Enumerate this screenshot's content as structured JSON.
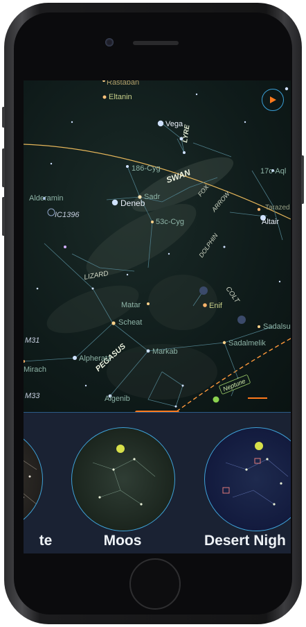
{
  "sky_map": {
    "stars": [
      {
        "name": "Rastaban"
      },
      {
        "name": "Eltanin"
      },
      {
        "name": "Vega"
      },
      {
        "name": "Deneb"
      },
      {
        "name": "Sadr"
      },
      {
        "name": "Altair"
      },
      {
        "name": "Alderamin"
      },
      {
        "name": "Matar"
      },
      {
        "name": "Scheat"
      },
      {
        "name": "Markab"
      },
      {
        "name": "Alpheratz"
      },
      {
        "name": "Algenib"
      },
      {
        "name": "Mirach"
      },
      {
        "name": "Enif"
      },
      {
        "name": "Sadalsuud"
      },
      {
        "name": "Sadalmelik"
      },
      {
        "name": "Tarazed"
      }
    ],
    "labels": {
      "rastaban": "Rastaban",
      "eltanin": "Eltanin",
      "vega": "Vega",
      "lyre": "LYRE",
      "swan": "SWAN",
      "cyg186": "186-Cyg",
      "aql17c": "17c-Aql",
      "alderamin": "Alderamin",
      "ic1396": "IC1396",
      "deneb": "Deneb",
      "sadr": "Sadr",
      "fox": "FOX",
      "arrow": "ARROW",
      "altair": "Altair",
      "cyg53c": "53c-Cyg",
      "dolphin": "DOLPHIN",
      "lizard": "LIZARD",
      "colt": "COLT",
      "matar": "Matar",
      "enif": "Enif",
      "sadalsuud": "Sadalsu",
      "scheat": "Scheat",
      "m31": "M31",
      "pegasus": "PEGASUS",
      "markab": "Markab",
      "sadalmelik": "Sadalmelik",
      "alpheratz": "Alpheratz",
      "mirach": "Mirach",
      "m33": "M33",
      "algenib": "Algenib",
      "neptune": "Neptune",
      "tarazed": "Tarazed"
    },
    "compass_icon": "compass-icon",
    "colors": {
      "ecliptic": "#e6b65a",
      "accent": "#ff7a1c",
      "border": "#3fa3d9",
      "star_label": "#c8d08a"
    }
  },
  "theme_picker": {
    "themes": [
      {
        "name": "te"
      },
      {
        "name": "Moos"
      },
      {
        "name": "Desert Nigh"
      }
    ]
  }
}
